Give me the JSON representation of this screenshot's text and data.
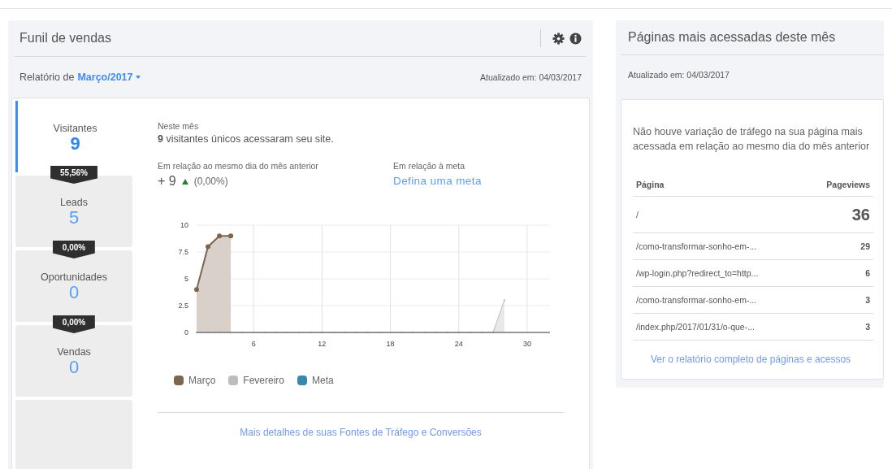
{
  "funnel": {
    "title": "Funil de vendas",
    "report_label": "Relatório de",
    "report_period": "Março/2017",
    "updated": "Atualizado em: 04/03/2017",
    "stages": [
      {
        "label": "Visitantes",
        "value": "9",
        "selected": true
      },
      {
        "label": "Leads",
        "value": "5",
        "rate": "55,56%",
        "selected": false
      },
      {
        "label": "Oportunidades",
        "value": "0",
        "rate": "0,00%",
        "selected": false
      },
      {
        "label": "Vendas",
        "value": "0",
        "rate": "0,00%",
        "selected": false
      }
    ],
    "summary": {
      "caption": "Neste mês",
      "text": "**9** visitantes únicos acessaram seu site."
    },
    "comparison": {
      "caption": "Em relação ao mesmo dia do mês anterior",
      "change": "+ 9",
      "percent": "(0,00%)"
    },
    "goal": {
      "caption": "Em relação à meta",
      "link": "Defina uma meta"
    },
    "chart_data": {
      "type": "area",
      "grid": true,
      "x": [
        1,
        2,
        3,
        4,
        5,
        6,
        7,
        8,
        9,
        10,
        11,
        12,
        13,
        14,
        15,
        16,
        17,
        18,
        19,
        20,
        21,
        22,
        23,
        24,
        25,
        26,
        27,
        28
      ],
      "xlim": [
        1,
        32
      ],
      "ylim": [
        0,
        10
      ],
      "xticks": [
        6,
        12,
        18,
        24,
        30
      ],
      "yticks": [
        0,
        2.5,
        5,
        7.5,
        10
      ],
      "series": [
        {
          "name": "Março",
          "color": "#7d6650",
          "values": [
            4,
            8,
            9,
            9,
            null,
            null,
            null,
            null,
            null,
            null,
            null,
            null,
            null,
            null,
            null,
            null,
            null,
            null,
            null,
            null,
            null,
            null,
            null,
            null,
            null,
            null,
            null,
            null
          ]
        },
        {
          "name": "Fevereiro",
          "color": "#bdbdbd",
          "values": [
            0,
            0,
            0,
            0,
            0,
            0,
            0,
            0,
            0,
            0,
            0,
            0,
            0,
            0,
            0,
            0,
            0,
            0,
            0,
            0,
            0,
            0,
            0,
            0,
            0,
            0,
            0,
            3
          ]
        },
        {
          "name": "Meta",
          "color": "#3a87ad",
          "values": [
            null,
            null,
            null,
            null,
            null,
            null,
            null,
            null,
            null,
            null,
            null,
            null,
            null,
            null,
            null,
            null,
            null,
            null,
            null,
            null,
            null,
            null,
            null,
            null,
            null,
            null,
            null,
            null
          ]
        }
      ]
    },
    "footer_link": "Mais detalhes de suas Fontes de Tráfego e Conversões"
  },
  "top_pages": {
    "title": "Páginas mais acessadas deste mês",
    "updated": "Atualizado em: 04/03/2017",
    "message": "Não houve variação de tráfego na sua página mais acessada em relação ao mesmo dia do mês anterior",
    "columns": [
      "Página",
      "Pageviews"
    ],
    "rows": [
      {
        "page": "/",
        "pageviews": "36"
      },
      {
        "page": "/como-transformar-sonho-em-...",
        "pageviews": "29"
      },
      {
        "page": "/wp-login.php?redirect_to=http...",
        "pageviews": "6"
      },
      {
        "page": "/como-transformar-sonho-em-...",
        "pageviews": "3"
      },
      {
        "page": "/index.php/2017/01/31/o-que-...",
        "pageviews": "3"
      }
    ],
    "footer_link": "Ver o relatório completo de páginas e acessos"
  }
}
